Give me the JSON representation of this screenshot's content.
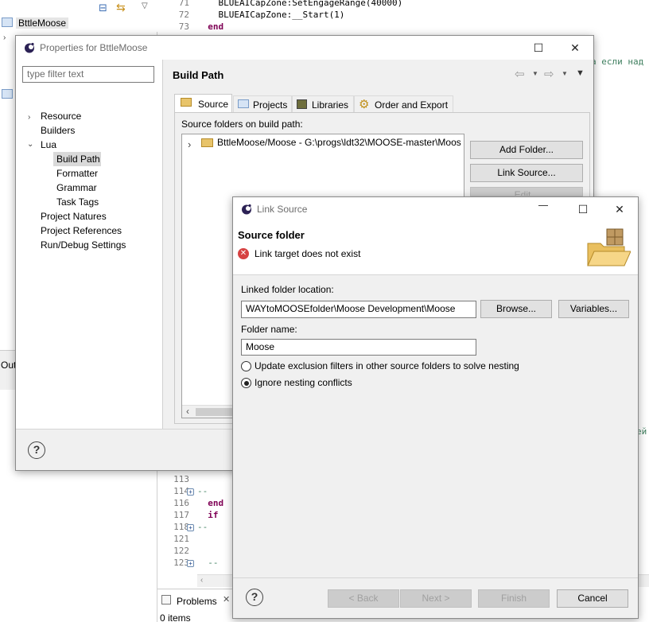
{
  "ide": {
    "project_name": "BttleMoose",
    "outline_label": "Out",
    "problems_tab": "Problems",
    "problems_count": "0 items",
    "right_comment_1": "а если над",
    "right_comment_2": "ей",
    "code_top": [
      {
        "n": "71",
        "text": "    BLUEAICapZone:SetEngageRange(40000)"
      },
      {
        "n": "72",
        "text": "    BLUEAICapZone:__Start(1)"
      },
      {
        "n": "73",
        "text": "  end"
      }
    ],
    "code_bottom": [
      {
        "n": "113",
        "text": ""
      },
      {
        "n": "114",
        "text": "--",
        "fold": true
      },
      {
        "n": "116",
        "text": "  end"
      },
      {
        "n": "117",
        "text": "  if"
      },
      {
        "n": "118",
        "text": "--",
        "fold": true
      },
      {
        "n": "121",
        "text": ""
      },
      {
        "n": "122",
        "text": ""
      },
      {
        "n": "123",
        "text": "  --",
        "fold": true
      }
    ]
  },
  "properties": {
    "title": "Properties for BttleMoose",
    "filter_placeholder": "type filter text",
    "tree": {
      "resource": "Resource",
      "builders": "Builders",
      "lua": "Lua",
      "build_path": "Build Path",
      "formatter": "Formatter",
      "grammar": "Grammar",
      "task_tags": "Task Tags",
      "project_natures": "Project Natures",
      "project_references": "Project References",
      "run_debug": "Run/Debug Settings"
    },
    "page_title": "Build Path",
    "tabs": {
      "source": "Source",
      "projects": "Projects",
      "libraries": "Libraries",
      "order": "Order and Export"
    },
    "source_folders_label": "Source folders on build path:",
    "source_entry": "BttleMoose/Moose - G:\\progs\\ldt32\\MOOSE-master\\Moos",
    "add_folder": "Add Folder...",
    "link_source": "Link Source...",
    "edit": "Edit..."
  },
  "link_source": {
    "title": "Link Source",
    "heading": "Source folder",
    "error": "Link target does not exist",
    "location_label": "Linked folder location:",
    "location_value": "WAYtoMOOSEfolder\\Moose Development\\Moose",
    "browse": "Browse...",
    "variables": "Variables...",
    "folder_name_label": "Folder name:",
    "folder_name_value": "Moose",
    "radio_update": "Update exclusion filters in other source folders to solve nesting",
    "radio_ignore": "Ignore nesting conflicts",
    "back": "< Back",
    "next": "Next >",
    "finish": "Finish",
    "cancel": "Cancel"
  }
}
